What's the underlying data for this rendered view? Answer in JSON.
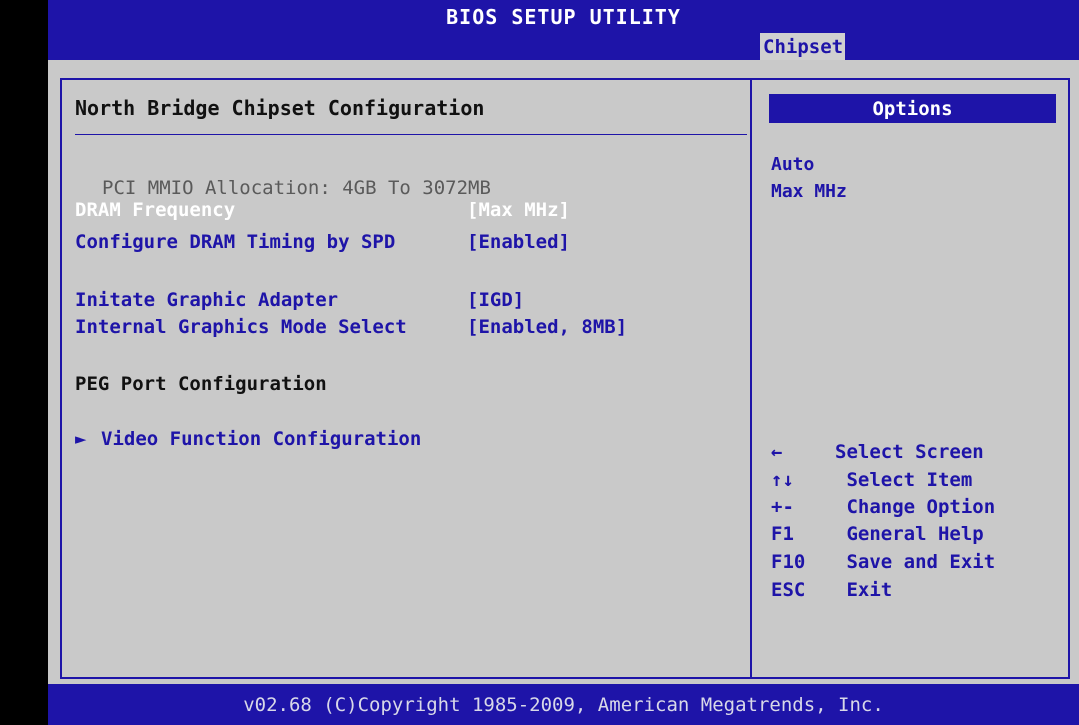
{
  "title": "BIOS SETUP UTILITY",
  "tabs": {
    "active": "Chipset"
  },
  "section": {
    "title": "North Bridge Chipset Configuration"
  },
  "items": [
    {
      "label": "PCI MMIO Allocation: 4GB To 3072MB",
      "value": ""
    },
    {
      "label": "DRAM Frequency",
      "value": "[Max MHz]"
    },
    {
      "label": "Configure DRAM Timing by SPD",
      "value": "[Enabled]"
    },
    {
      "label": "Initate Graphic Adapter",
      "value": "[IGD]"
    },
    {
      "label": "Internal Graphics Mode Select",
      "value": "[Enabled, 8MB]"
    },
    {
      "label": "PEG Port Configuration",
      "value": ""
    },
    {
      "label": "Video Function Configuration",
      "value": "",
      "arrow": "►"
    }
  ],
  "options": {
    "header": "Options",
    "list": [
      "Auto",
      "Max MHz"
    ]
  },
  "help": [
    {
      "key": "←",
      "desc": "Select Screen"
    },
    {
      "key": "↑↓",
      "desc": " Select Item"
    },
    {
      "key": "+-",
      "desc": " Change Option"
    },
    {
      "key": "F1",
      "desc": " General Help"
    },
    {
      "key": "F10",
      "desc": " Save and Exit"
    },
    {
      "key": "ESC",
      "desc": " Exit"
    }
  ],
  "footer": "v02.68 (C)Copyright 1985-2009, American Megatrends, Inc.",
  "colors": {
    "primary_blue": "#1e14a8",
    "panel_gray": "#c9c9c9",
    "highlight_white": "#ffffff"
  }
}
